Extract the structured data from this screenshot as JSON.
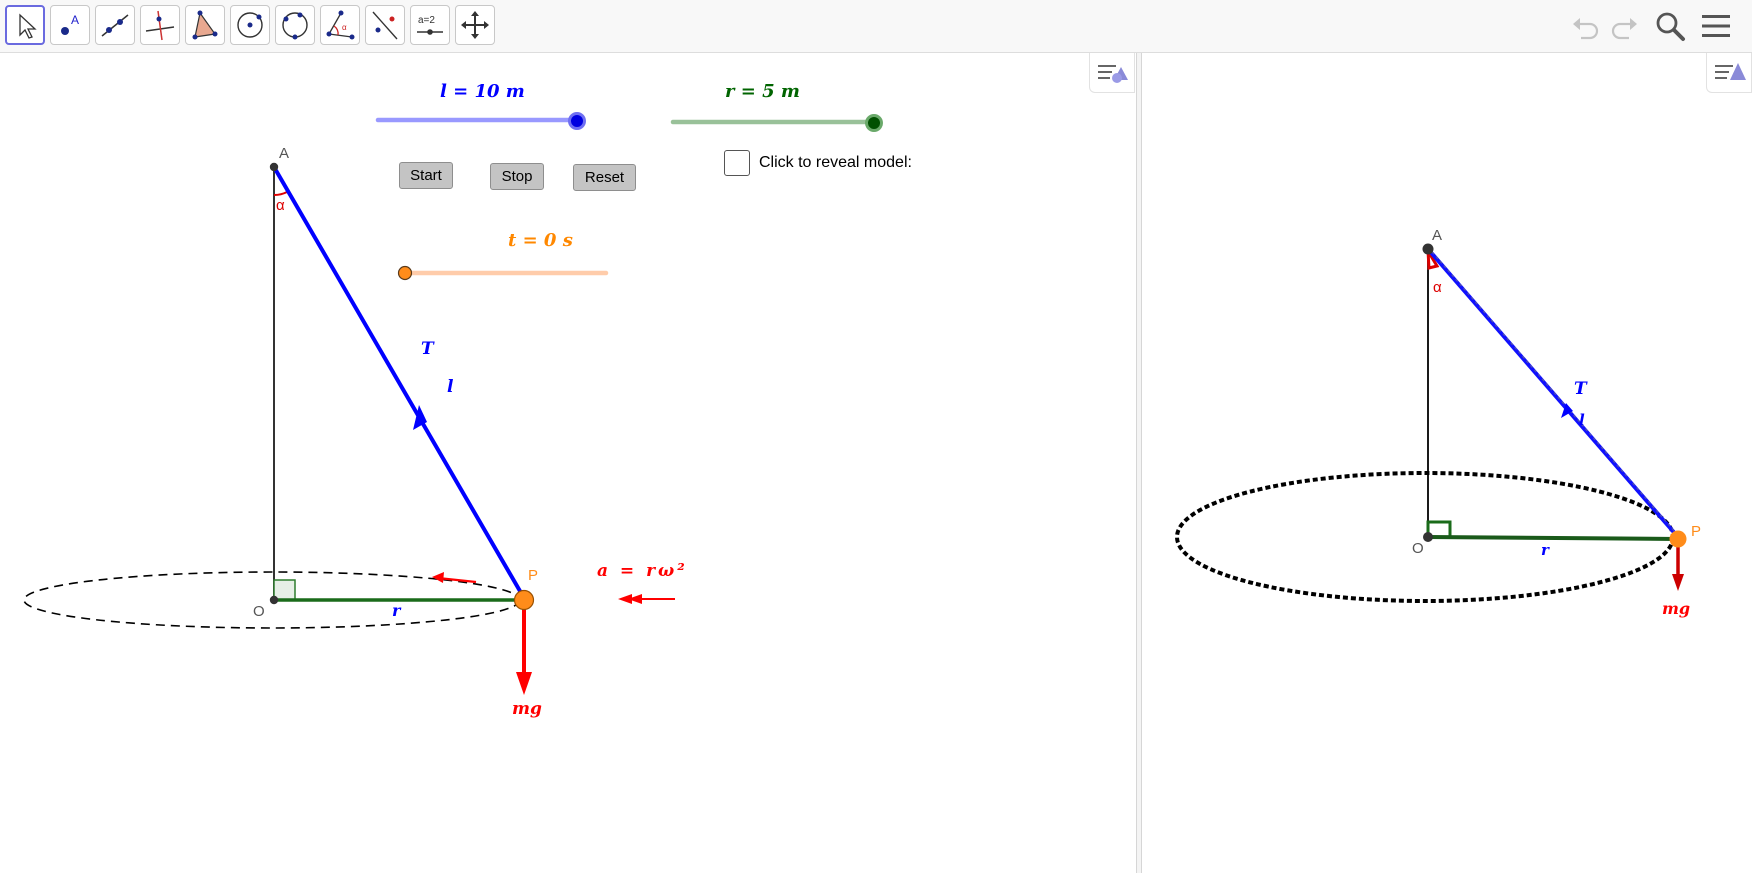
{
  "toolbar": {
    "tools": [
      {
        "name": "move-tool-icon"
      },
      {
        "name": "point-tool-icon",
        "glyph": "A"
      },
      {
        "name": "line-tool-icon"
      },
      {
        "name": "perpendicular-line-tool-icon"
      },
      {
        "name": "polygon-tool-icon"
      },
      {
        "name": "circle-center-point-tool-icon"
      },
      {
        "name": "circle-three-points-tool-icon"
      },
      {
        "name": "angle-tool-icon"
      },
      {
        "name": "reflect-tool-icon"
      },
      {
        "name": "slider-tool-icon",
        "glyph": "a=2"
      },
      {
        "name": "move-graphics-view-tool-icon"
      }
    ],
    "right_icons": [
      "undo-icon",
      "redo-icon",
      "search-icon",
      "menu-icon"
    ]
  },
  "left_view": {
    "slider_l": {
      "label": "l = 10 m",
      "value": 10,
      "color": "#0000ff",
      "track_color": "#9999ff"
    },
    "slider_r": {
      "label": "r = 5 m",
      "value": 5,
      "color": "#006400",
      "track_color": "#99c199"
    },
    "slider_t": {
      "label": "t = 0 s",
      "value": 0,
      "color": "#ff8800",
      "track_color": "#ffccaa"
    },
    "buttons": {
      "start": "Start",
      "stop": "Stop",
      "reset": "Reset"
    },
    "checkbox": {
      "label": "Click to reveal model:",
      "checked": false
    },
    "points": {
      "A": "A",
      "O": "O",
      "P": "P"
    },
    "angle_label": "α",
    "tension_label": "T",
    "length_label": "l",
    "radius_label": "r",
    "weight_label": "mg",
    "acceleration_formula": "a = rω²",
    "colors": {
      "string": "#0000ff",
      "radius": "#1a6b1a",
      "force": "#ff0000",
      "point_p": "#ff8c1a",
      "orbit": "#000000"
    }
  },
  "right_view": {
    "points": {
      "A": "A",
      "O": "O",
      "P": "P"
    },
    "angle_label": "α",
    "tension_label": "T",
    "length_label": "l",
    "radius_label": "r",
    "weight_label": "mg"
  }
}
